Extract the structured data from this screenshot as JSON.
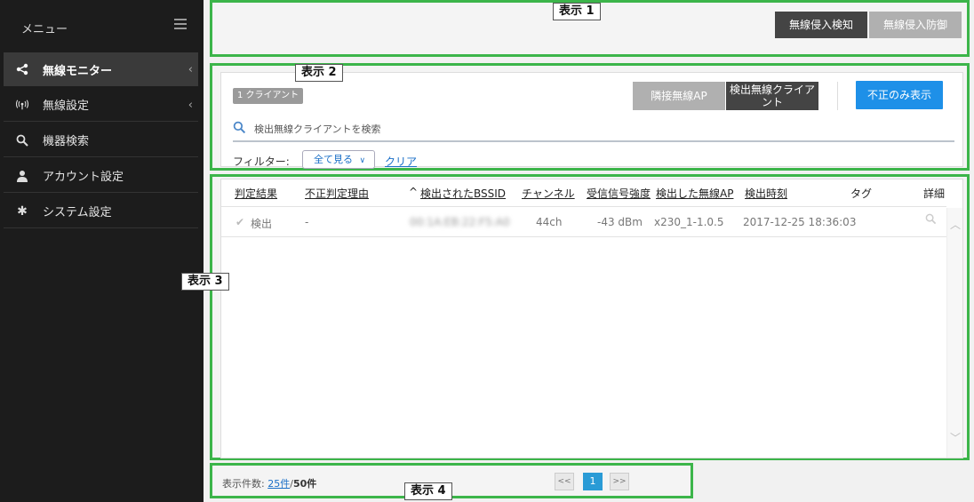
{
  "sidebar": {
    "title": "メニュー",
    "items": [
      {
        "label": "無線モニター",
        "icon": "share-icon"
      },
      {
        "label": "無線設定",
        "icon": "wifi-antenna-icon"
      },
      {
        "label": "機器検索",
        "icon": "search-icon"
      },
      {
        "label": "アカウント設定",
        "icon": "user-icon"
      },
      {
        "label": "システム設定",
        "icon": "gear-icon"
      }
    ]
  },
  "annotations": {
    "a1": "表示 1",
    "a2": "表示 2",
    "a3": "表示 3",
    "a4": "表示 4"
  },
  "header": {
    "detect_button": "無線侵入検知",
    "prevent_button": "無線侵入防御"
  },
  "panel": {
    "count_badge": "1 クライアント",
    "neighbor_ap_button": "隣接無線AP",
    "detected_clients_button": "検出無線クライアント",
    "rogue_only_button": "不正のみ表示",
    "search_placeholder": "検出無線クライアントを検索",
    "filter_label": "フィルター:",
    "filter_value": "全て見る",
    "filter_clear": "クリア"
  },
  "table": {
    "columns": [
      "判定結果",
      "不正判定理由",
      "検出されたBSSID",
      "チャンネル",
      "受信信号強度",
      "検出した無線AP",
      "検出時刻",
      "タグ",
      "詳細"
    ],
    "sort_indicator": "^",
    "rows": [
      {
        "result": "検出",
        "reason": "-",
        "bssid": "00:1A:EB:22:F5:A0",
        "channel": "44ch",
        "rssi": "-43 dBm",
        "ap": "x230_1-1.0.5",
        "time": "2017-12-25 18:36:03",
        "tag": ""
      }
    ]
  },
  "pagination": {
    "label": "表示件数:",
    "per_page": "25件",
    "separator": "/",
    "total": "50件",
    "first": "<<",
    "current": "1",
    "last": ">>"
  },
  "colors": {
    "annotation_border": "#3cb54a",
    "primary_blue": "#1e90e8",
    "dark_button": "#444444",
    "sidebar_bg": "#1c1c1c"
  }
}
